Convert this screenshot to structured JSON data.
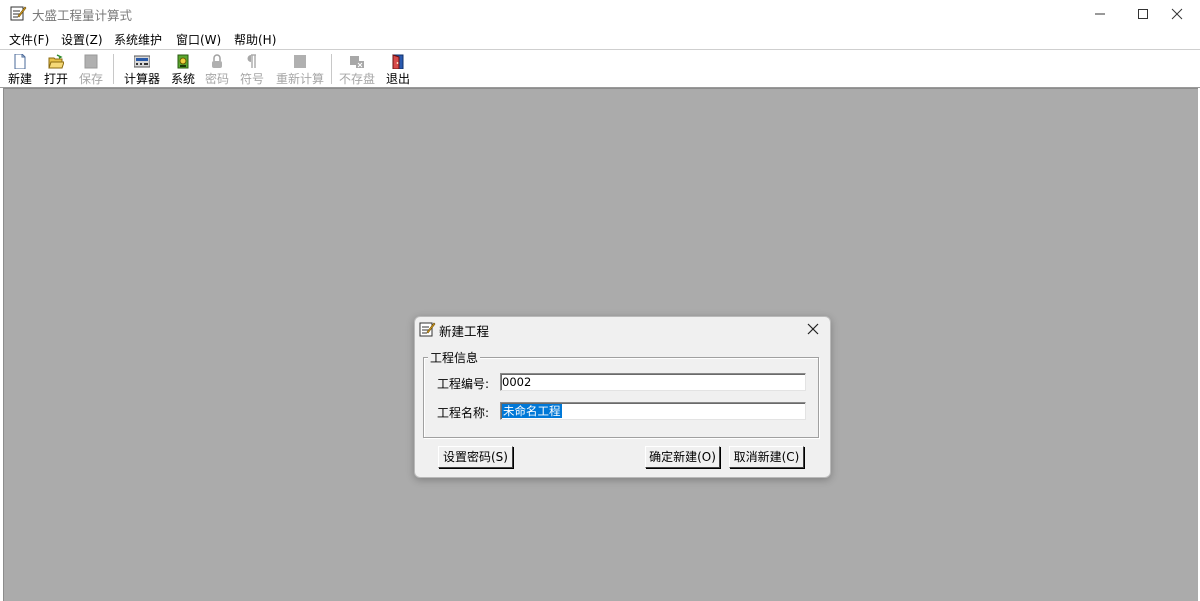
{
  "window": {
    "title": "大盛工程量计算式"
  },
  "menu": [
    {
      "label": "文件(F)"
    },
    {
      "label": "设置(Z)"
    },
    {
      "label": "系统维护"
    },
    {
      "label": "窗口(W)"
    },
    {
      "label": "帮助(H)"
    }
  ],
  "toolbar": {
    "new": "新建",
    "open": "打开",
    "save": "保存",
    "calculator": "计算器",
    "system": "系统",
    "password": "密码",
    "symbol": "符号",
    "recalc": "重新计算",
    "no_save": "不存盘",
    "exit": "退出"
  },
  "dialog": {
    "title": "新建工程",
    "group_title": "工程信息",
    "project_no_label": "工程编号:",
    "project_no_value": "0002",
    "project_name_label": "工程名称:",
    "project_name_value": "未命名工程",
    "set_password_button": "设置密码(S)",
    "confirm_button": "确定新建(O)",
    "cancel_button": "取消新建(C)"
  },
  "colors": {
    "mdi_background": "#ababab",
    "dialog_background": "#f0f0f0",
    "selection": "#0078d7",
    "disabled_text": "#a6a6a6"
  },
  "icons": [
    "app-notepad-icon",
    "minimize-icon",
    "maximize-icon",
    "close-icon",
    "new-file-icon",
    "open-folder-icon",
    "save-icon",
    "calculator-icon",
    "system-icon",
    "lock-icon",
    "pilcrow-icon",
    "recalc-icon",
    "no-save-icon",
    "exit-door-icon"
  ]
}
